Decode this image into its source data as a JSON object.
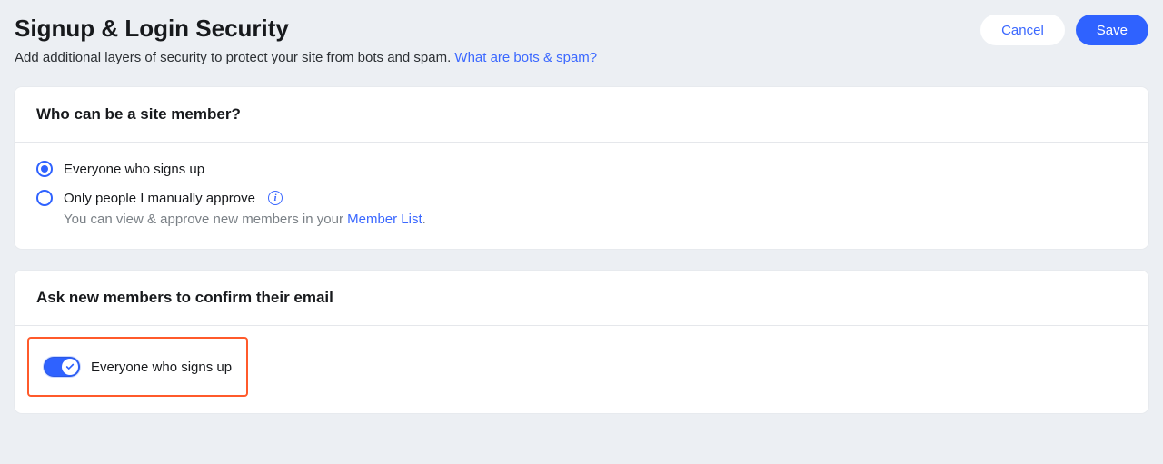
{
  "header": {
    "title": "Signup & Login Security",
    "subtitle": "Add additional layers of security to protect your site from bots and spam. ",
    "subtitle_link": "What are bots & spam?",
    "cancel_label": "Cancel",
    "save_label": "Save"
  },
  "card1": {
    "title": "Who can be a site member?",
    "option1_label": "Everyone who signs up",
    "option2_label": "Only people I manually approve",
    "option2_help_prefix": "You can view & approve new members in your ",
    "option2_help_link": "Member List",
    "option2_help_suffix": "."
  },
  "card2": {
    "title": "Ask new members to confirm their email",
    "toggle_label": "Everyone who signs up"
  }
}
